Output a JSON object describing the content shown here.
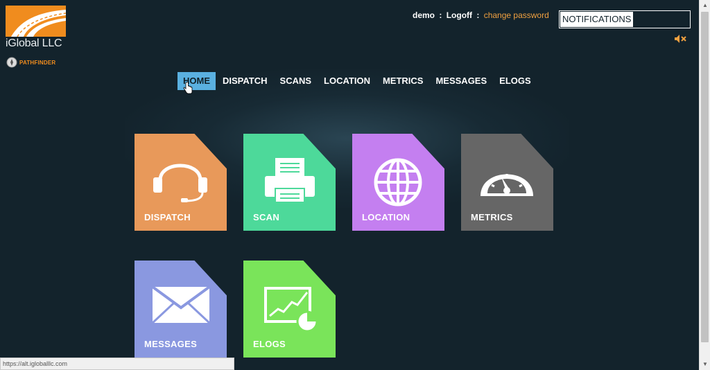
{
  "brand": {
    "company": "iGlobal LLC",
    "product": "PATHFINDER",
    "accent": "#f08c1e"
  },
  "topbar": {
    "user": "demo",
    "separator": ":",
    "logoff": "Logoff",
    "change_password": "change password",
    "notifications_label": "NOTIFICATIONS"
  },
  "nav": {
    "items": [
      {
        "label": "HOME",
        "active": true
      },
      {
        "label": "DISPATCH"
      },
      {
        "label": "SCANS"
      },
      {
        "label": "LOCATION"
      },
      {
        "label": "METRICS"
      },
      {
        "label": "MESSAGES"
      },
      {
        "label": "ELOGS"
      }
    ]
  },
  "tiles": [
    {
      "label": "DISPATCH",
      "icon": "headset-icon",
      "color": "#e8995a"
    },
    {
      "label": "SCAN",
      "icon": "printer-icon",
      "color": "#4dd99a"
    },
    {
      "label": "LOCATION",
      "icon": "globe-icon",
      "color": "#c47ff0"
    },
    {
      "label": "METRICS",
      "icon": "gauge-icon",
      "color": "#666666"
    },
    {
      "label": "MESSAGES",
      "icon": "envelope-icon",
      "color": "#8a98e0"
    },
    {
      "label": "ELOGS",
      "icon": "chart-icon",
      "color": "#7ae45a"
    }
  ],
  "status": {
    "url": "https://alt.igloballlc.com"
  }
}
